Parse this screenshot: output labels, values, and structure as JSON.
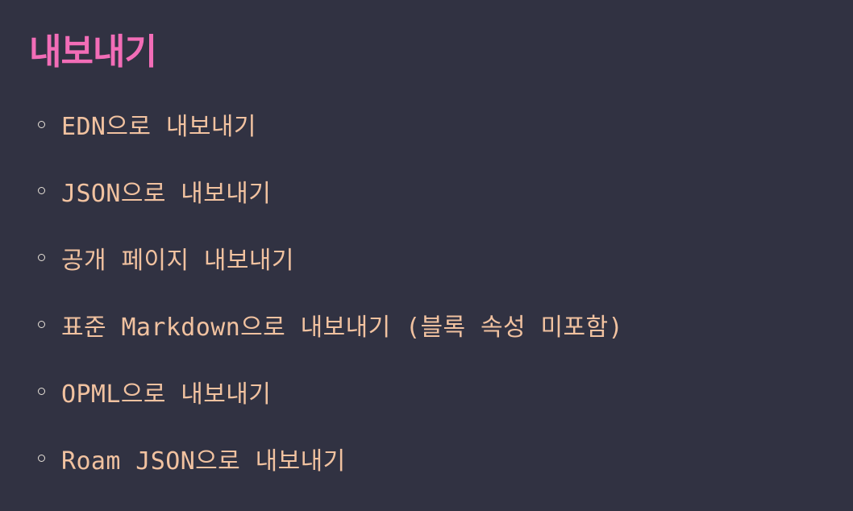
{
  "page": {
    "title": "내보내기"
  },
  "export_options": [
    {
      "label": "EDN으로 내보내기"
    },
    {
      "label": "JSON으로 내보내기"
    },
    {
      "label": "공개 페이지 내보내기"
    },
    {
      "label": "표준 Markdown으로 내보내기 (블록 속성 미포함)"
    },
    {
      "label": "OPML으로 내보내기"
    },
    {
      "label": "Roam JSON으로 내보내기"
    }
  ],
  "colors": {
    "background": "#313242",
    "title": "#f26db7",
    "item_text": "#f1c2a0",
    "bullet": "#e8e2d8"
  }
}
